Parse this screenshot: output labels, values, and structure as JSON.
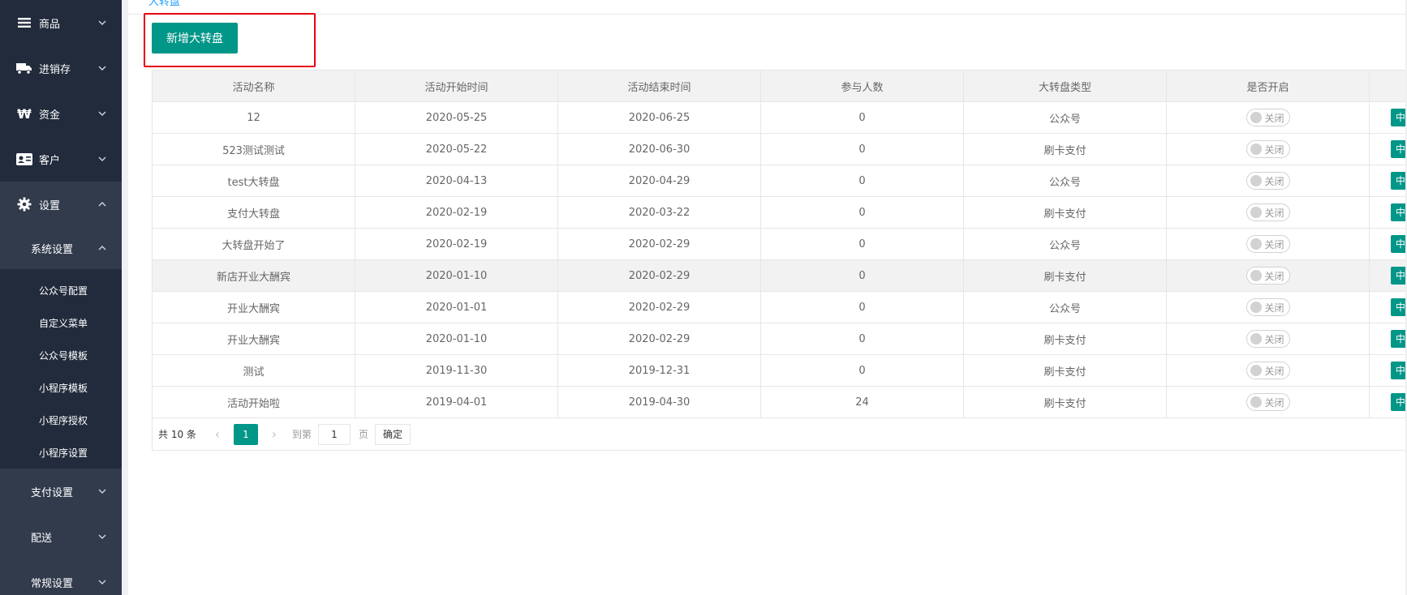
{
  "sidebar": {
    "top_menus": [
      {
        "label": "商品",
        "icon": "list-icon"
      },
      {
        "label": "进销存",
        "icon": "truck-icon"
      },
      {
        "label": "资金",
        "icon": "won-icon"
      },
      {
        "label": "客户",
        "icon": "id-card-icon"
      },
      {
        "label": "设置",
        "icon": "gear-icon"
      }
    ],
    "system_settings": {
      "title": "系统设置",
      "items": [
        "公众号配置",
        "自定义菜单",
        "公众号模板",
        "小程序模板",
        "小程序授权",
        "小程序设置"
      ]
    },
    "more_groups": [
      "支付设置",
      "配送",
      "常规设置"
    ]
  },
  "breadcrumb": {
    "current": "大转盘"
  },
  "toolbar": {
    "add_label": "新增大转盘"
  },
  "table": {
    "headers": [
      "活动名称",
      "活动开始时间",
      "活动结束时间",
      "参与人数",
      "大转盘类型",
      "是否开启"
    ],
    "switch_label": "关闭",
    "action_label": "中奖",
    "rows": [
      {
        "name": "12",
        "start": "2020-05-25",
        "end": "2020-06-25",
        "count": "0",
        "type": "公众号"
      },
      {
        "name": "523测试测试",
        "start": "2020-05-22",
        "end": "2020-06-30",
        "count": "0",
        "type": "刷卡支付"
      },
      {
        "name": "test大转盘",
        "start": "2020-04-13",
        "end": "2020-04-29",
        "count": "0",
        "type": "公众号"
      },
      {
        "name": "支付大转盘",
        "start": "2020-02-19",
        "end": "2020-03-22",
        "count": "0",
        "type": "刷卡支付"
      },
      {
        "name": "大转盘开始了",
        "start": "2020-02-19",
        "end": "2020-02-29",
        "count": "0",
        "type": "公众号"
      },
      {
        "name": "新店开业大酬宾",
        "start": "2020-01-10",
        "end": "2020-02-29",
        "count": "0",
        "type": "刷卡支付"
      },
      {
        "name": "开业大酬宾",
        "start": "2020-01-01",
        "end": "2020-02-29",
        "count": "0",
        "type": "公众号"
      },
      {
        "name": "开业大酬宾",
        "start": "2020-01-10",
        "end": "2020-02-29",
        "count": "0",
        "type": "刷卡支付"
      },
      {
        "name": "测试",
        "start": "2019-11-30",
        "end": "2019-12-31",
        "count": "0",
        "type": "刷卡支付"
      },
      {
        "name": "活动开始啦",
        "start": "2019-04-01",
        "end": "2019-04-30",
        "count": "24",
        "type": "刷卡支付"
      }
    ]
  },
  "pagination": {
    "total_text": "共 10 条",
    "current_page": "1",
    "goto_label": "到第",
    "input_value": "1",
    "page_unit": "页",
    "confirm_label": "确定"
  },
  "colors": {
    "primary": "#009688",
    "sidebar": "#222b3c",
    "highlight": "#e60012"
  }
}
